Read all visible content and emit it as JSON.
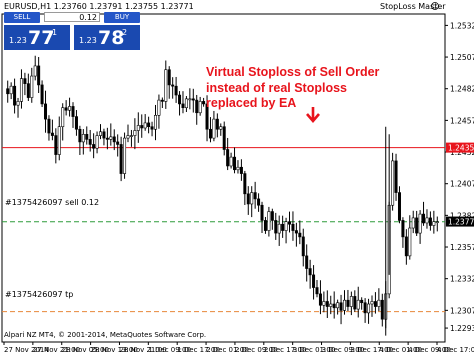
{
  "chart_header": "EURUSD,H1  1.23760 1.23791 1.23755 1.23771",
  "ea_name": "StopLoss Master",
  "ea_icon": "smiley-icon",
  "trade_panel": {
    "sell_label": "SELL",
    "buy_label": "BUY",
    "lot": "0.12",
    "sell_price_small": "1.23",
    "sell_price_big": "77",
    "sell_price_sup": "1",
    "buy_price_small": "1.23",
    "buy_price_big": "78",
    "buy_price_sup": "2"
  },
  "annotation": {
    "lines": [
      "Virtual Stoploss of Sell Order",
      "instead of real Stoploss",
      "replaced by EA"
    ],
    "color": "#e8141c",
    "arrow": "down-arrow-icon"
  },
  "order_labels": {
    "sell": "#1375426097 sell 0.12",
    "tp": "#1375426097 tp"
  },
  "copyright": "Alpari NZ MT4, © 2001-2014, MetaQuotes Software Corp.",
  "colors": {
    "stoploss_line": "#e8141c",
    "entry_line": "#2e9b3a",
    "tp_line": "#e8873a",
    "candles": "#000000",
    "current_price_bg": "#000000"
  },
  "chart_data": {
    "type": "candlestick",
    "symbol": "EURUSD",
    "timeframe": "H1",
    "ylim": [
      1.2282,
      1.2541
    ],
    "y_ticks": [
      1.2532,
      1.2507,
      1.2482,
      1.2457,
      1.2432,
      1.2407,
      1.2382,
      1.2357,
      1.2332,
      1.2307,
      1.2293
    ],
    "x_tick_labels": [
      "27 Nov 2014",
      "27 Nov 21:00",
      "28 Nov 05:00",
      "28 Nov 13:00",
      "28 Nov 21:00",
      "1 Dec 09:00",
      "1 Dec 17:00",
      "2 Dec 01:00",
      "2 Dec 09:00",
      "2 Dec 17:00",
      "3 Dec 01:00",
      "3 Dec 09:00",
      "3 Dec 17:00",
      "4 Dec 01:00",
      "4 Dec 09:00",
      "4 Dec 17:00"
    ],
    "levels": {
      "stoploss": 1.24355,
      "current": 1.23771,
      "sell_entry": 1.2377,
      "take_profit": 1.2306
    },
    "level_labels": {
      "stoploss": "1.24355",
      "current": "1.23771"
    },
    "closes": [
      1.2478,
      1.2484,
      1.2469,
      1.2472,
      1.249,
      1.2486,
      1.2475,
      1.2492,
      1.25,
      1.2485,
      1.247,
      1.2458,
      1.2447,
      1.2445,
      1.243,
      1.2452,
      1.2467,
      1.2465,
      1.2468,
      1.246,
      1.245,
      1.244,
      1.2446,
      1.2442,
      1.2438,
      1.2435,
      1.2445,
      1.2448,
      1.2443,
      1.2442,
      1.2444,
      1.244,
      1.2438,
      1.2415,
      1.2443,
      1.2445,
      1.2445,
      1.2449,
      1.2453,
      1.2451,
      1.2455,
      1.2452,
      1.245,
      1.2461,
      1.2473,
      1.2472,
      1.2497,
      1.2485,
      1.2484,
      1.2477,
      1.247,
      1.2467,
      1.2474,
      1.2474,
      1.2473,
      1.2463,
      1.2472,
      1.247,
      1.245,
      1.2443,
      1.2458,
      1.245,
      1.2452,
      1.2434,
      1.2421,
      1.2428,
      1.2418,
      1.242,
      1.2415,
      1.2399,
      1.2391,
      1.24,
      1.2395,
      1.239,
      1.2378,
      1.237,
      1.2385,
      1.2378,
      1.2368,
      1.2375,
      1.237,
      1.2377,
      1.2375,
      1.237,
      1.2368,
      1.2365,
      1.235,
      1.234,
      1.2335,
      1.2325,
      1.232,
      1.2311,
      1.2314,
      1.231,
      1.2312,
      1.2309,
      1.2313,
      1.2307,
      1.2315,
      1.231,
      1.2318,
      1.2308,
      1.2315,
      1.2313,
      1.2305,
      1.2312,
      1.2314,
      1.231,
      1.2315,
      1.23,
      1.232,
      1.239,
      1.2425,
      1.24,
      1.2378,
      1.2365,
      1.235,
      1.2372,
      1.238,
      1.2368,
      1.2383,
      1.2376,
      1.238,
      1.2374,
      1.2377,
      1.2377
    ]
  }
}
